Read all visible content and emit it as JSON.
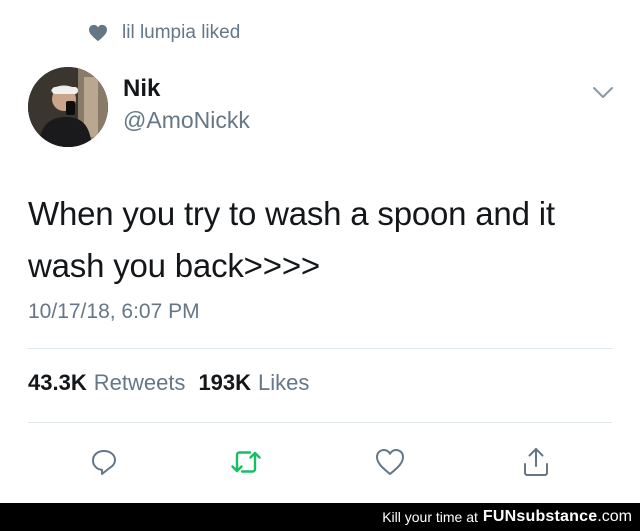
{
  "liked_by": {
    "text": "lil lumpia liked",
    "icon": "heart-icon"
  },
  "author": {
    "name": "Nik",
    "handle": "@AmoNickk",
    "avatar": "avatar-photo"
  },
  "tweet": {
    "text_line1": "When you try to wash a spoon and it",
    "text_line2": "wash you back>>>>",
    "timestamp": "10/17/18, 6:07 PM"
  },
  "stats": {
    "retweets_count": "43.3K",
    "retweets_label": "Retweets",
    "likes_count": "193K",
    "likes_label": "Likes"
  },
  "actions": [
    {
      "icon": "reply-icon"
    },
    {
      "icon": "retweet-icon",
      "color": "#17bf63"
    },
    {
      "icon": "heart-outline-icon"
    },
    {
      "icon": "share-icon"
    }
  ],
  "watermark": {
    "prefix": "Kill your time at",
    "brand": "FUNsubstance",
    "suffix": ".com"
  },
  "colors": {
    "text": "#14171a",
    "secondary": "#657786",
    "retweet": "#17bf63",
    "divider": "#e1e8ed"
  }
}
